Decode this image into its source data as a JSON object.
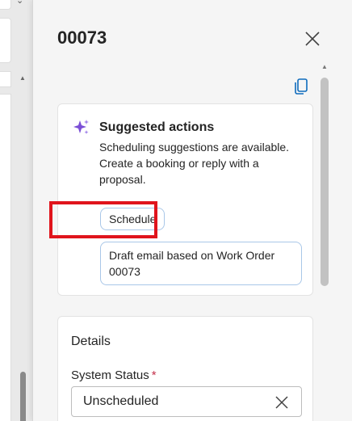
{
  "panel": {
    "title": "00073"
  },
  "suggested_actions": {
    "title": "Suggested actions",
    "description": "Scheduling suggestions are available. Create a booking or reply with a proposal.",
    "actions": [
      {
        "label": "Schedule"
      },
      {
        "label": "Draft email based on Work Order 00073"
      }
    ]
  },
  "details": {
    "title": "Details",
    "system_status": {
      "label": "System Status",
      "required_mark": "*",
      "value": "Unscheduled"
    }
  },
  "icons": {
    "close": "close-icon",
    "copy": "copy-icon",
    "sparkle": "sparkle-icon",
    "clear": "clear-icon"
  },
  "colors": {
    "accent": "#0f6cbd",
    "sparkle": "#7b4fd6",
    "highlight": "#e0141c",
    "required": "#c4314b"
  }
}
